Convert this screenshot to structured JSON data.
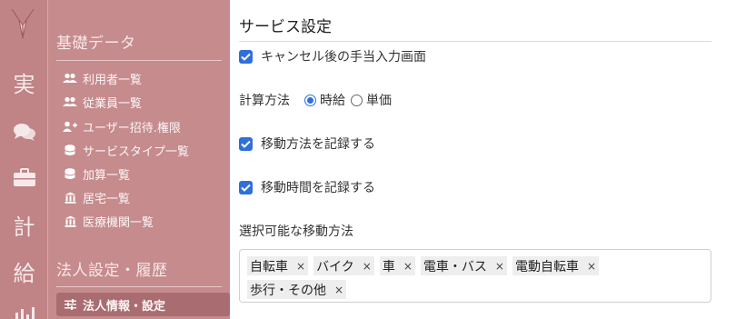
{
  "rail": {
    "items": [
      {
        "icon": "jitsu-text",
        "label": "実"
      },
      {
        "icon": "chat-icon",
        "label": ""
      },
      {
        "icon": "briefcase-icon",
        "label": ""
      },
      {
        "icon": "kei-text",
        "label": "計"
      },
      {
        "icon": "kyu-text",
        "label": "給"
      },
      {
        "icon": "bar-chart-icon",
        "label": ""
      }
    ]
  },
  "sidebar": {
    "sections": [
      {
        "title": "基礎データ",
        "items": [
          {
            "icon": "users-icon",
            "label": "利用者一覧"
          },
          {
            "icon": "users-icon",
            "label": "従業員一覧"
          },
          {
            "icon": "user-plus-icon",
            "label": "ユーザー招待.権限"
          },
          {
            "icon": "database-icon",
            "label": "サービスタイプ一覧"
          },
          {
            "icon": "database-icon",
            "label": "加算一覧"
          },
          {
            "icon": "building-icon",
            "label": "居宅一覧"
          },
          {
            "icon": "building-icon",
            "label": "医療機関一覧"
          }
        ]
      },
      {
        "title": "法人設定・履歴",
        "items": [
          {
            "icon": "sliders-icon",
            "label": "法人情報・設定",
            "active": true
          }
        ]
      }
    ]
  },
  "main": {
    "title": "サービス設定",
    "cancel_input_label": "キャンセル後の手当入力画面",
    "calc_method": {
      "label": "計算方法",
      "options": [
        "時給",
        "単価"
      ],
      "selected": "時給"
    },
    "record_method_label": "移動方法を記録する",
    "record_time_label": "移動時間を記録する",
    "methods": {
      "label": "選択可能な移動方法",
      "tags": [
        "自転車",
        "バイク",
        "車",
        "電車・バス",
        "電動自転車",
        "歩行・その他"
      ],
      "remove_glyph": "×"
    }
  },
  "colors": {
    "rail_bg": "#c08386",
    "sidebar_bg": "#c58b8d",
    "active_item_bg": "#a96c70",
    "accent": "#2f6fd9"
  }
}
